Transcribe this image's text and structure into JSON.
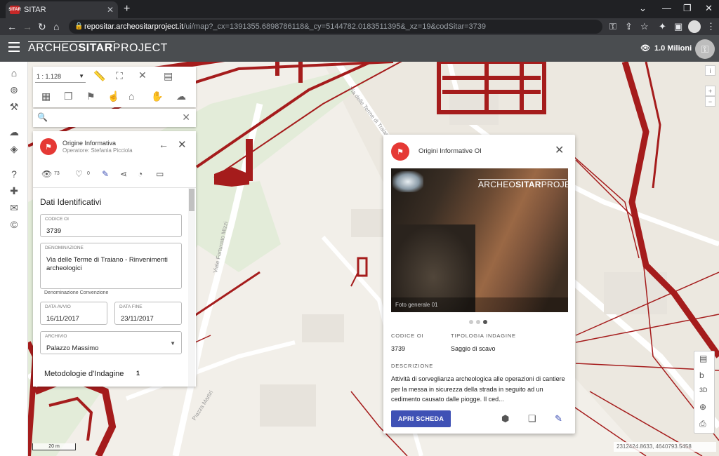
{
  "browser": {
    "tab_title": "SITAR",
    "url_host": "repositar.archeositarproject.it",
    "url_rest": "/ui/map?_cx=1391355.6898786118&_cy=5144782.0183511395&_xz=19&codSitar=3739"
  },
  "header": {
    "logo_prefix": "ARCHEO",
    "logo_bold": "SITAR",
    "logo_suffix": "PROJECT",
    "views": "1.0 Milioni"
  },
  "toolbar": {
    "scale": "1 : 1.128"
  },
  "search": {
    "placeholder": ""
  },
  "detail": {
    "title": "Origine Informativa",
    "operator": "Operatore: Stefania Picciola",
    "views_count": "73",
    "likes_count": "0",
    "section_title": "Dati Identificativi",
    "codice_label": "CODICE OI",
    "codice_value": "3739",
    "denominazione_label": "DENOMINAZIONE",
    "denominazione_value": "Via delle Terme di Traiano - Rinvenimenti archeologici",
    "convenzione_label": "Denominazione Convenzione",
    "data_avvio_label": "DATA AVVIO",
    "data_avvio_value": "16/11/2017",
    "data_fine_label": "DATA FINE",
    "data_fine_value": "23/11/2017",
    "archivio_label": "ARCHIVIO",
    "archivio_value": "Palazzo Massimo",
    "metodologie_label": "Metodologie d'Indagine",
    "metodologie_count": "1"
  },
  "card": {
    "title": "Origini Informative OI",
    "photo_brand_prefix": "ARCHEO",
    "photo_brand_bold": "SITAR",
    "photo_brand_suffix": "PROJECT",
    "photo_caption": "Foto generale 01",
    "codice_label": "CODICE OI",
    "codice_value": "3739",
    "tipologia_label": "TIPOLOGIA INDAGINE",
    "tipologia_value": "Saggio di scavo",
    "descrizione_label": "DESCRIZIONE",
    "descrizione_value": "Attività di sorveglianza archeologica alle operazioni di cantiere per la messa in sicurezza della strada in seguito ad un cedimento causato dalle piogge. Il ced...",
    "open_button": "APRI SCHEDA"
  },
  "map": {
    "street_1": "Via delle Terme di Traiano",
    "street_2": "Viale Fortunato Mizzi",
    "street_3": "Piazza Martiri",
    "scale_label": "20 m",
    "coords": "2312424.8633, 4640793.5458",
    "colors": {
      "feature": "#a51c1c",
      "land": "#f2efe9",
      "park": "#e3ecd9",
      "road": "#ffffff"
    }
  }
}
